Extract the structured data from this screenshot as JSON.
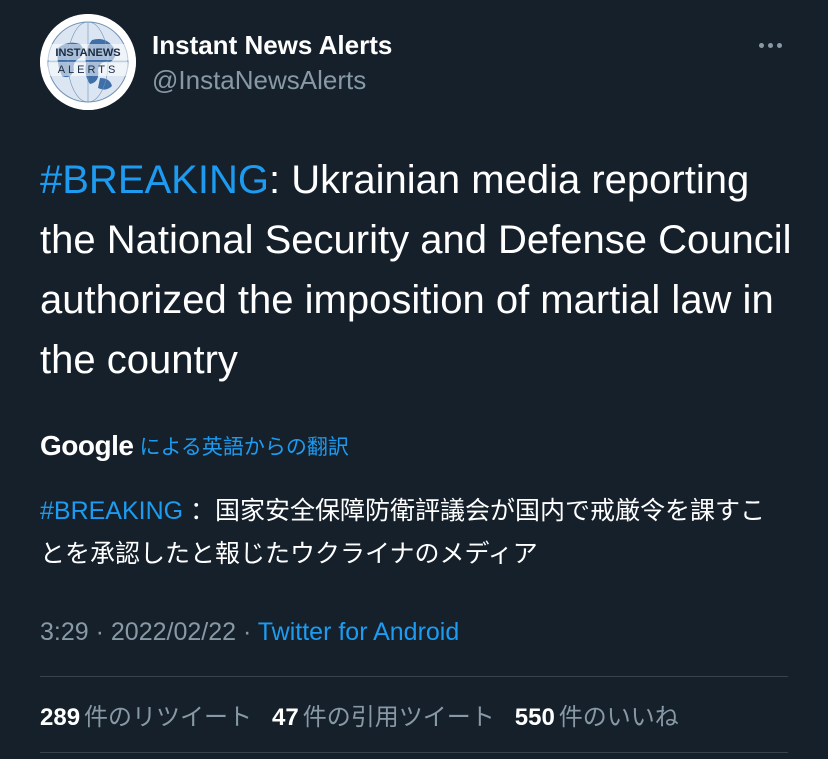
{
  "header": {
    "display_name": "Instant News Alerts",
    "handle": "@InstaNewsAlerts",
    "avatar_logo": "INSTANEWS ALERTS",
    "more_icon": "more-horizontal-icon"
  },
  "tweet": {
    "hashtag": "#BREAKING",
    "body_rest": ": Ukrainian media reporting the National Security and Defense Council authorized the imposition of martial law in the country"
  },
  "translation": {
    "provider": "Google",
    "label": "による英語からの翻訳",
    "hashtag": "#BREAKING",
    "text": " ：国家安全保障防衛評議会が国内で戒厳令を課すことを承認したと報じたウクライナのメディア"
  },
  "meta": {
    "time": "3:29",
    "separator": " · ",
    "date": "2022/02/22",
    "source": "Twitter for Android"
  },
  "stats": {
    "retweets": {
      "count": "289",
      "label": "件のリツイート"
    },
    "quotes": {
      "count": "47",
      "label": "件の引用ツイート"
    },
    "likes": {
      "count": "550",
      "label": "件のいいね"
    }
  },
  "colors": {
    "background": "#15202b",
    "link": "#1d9bf0",
    "secondary_text": "#8899a6",
    "divider": "#38444d"
  }
}
